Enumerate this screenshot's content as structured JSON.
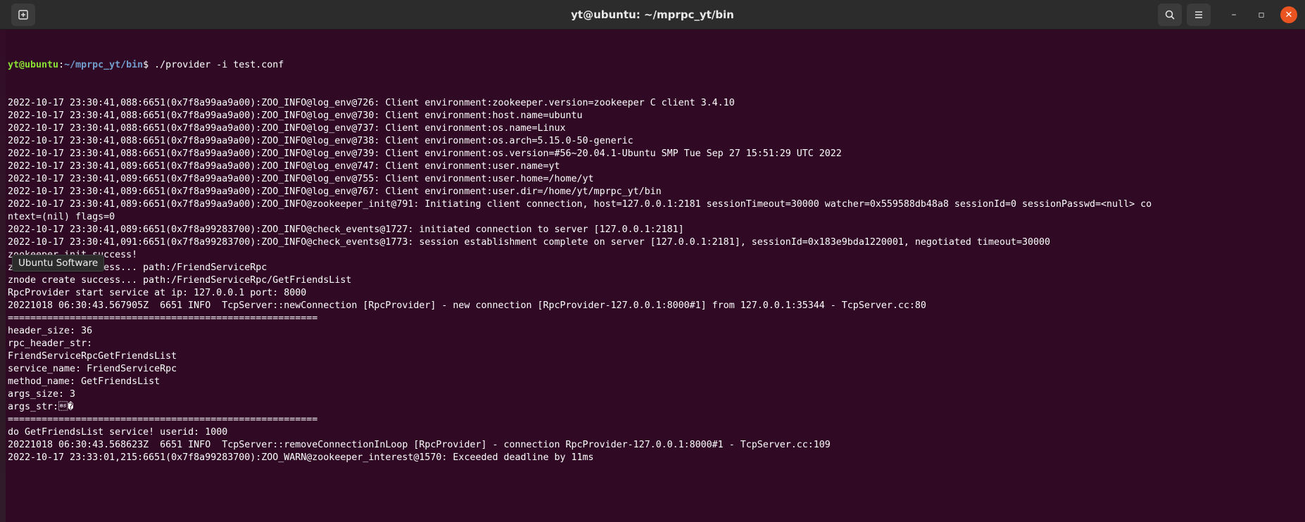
{
  "window": {
    "title": "yt@ubuntu: ~/mprpc_yt/bin",
    "icons": {
      "new_tab": "new-tab-icon",
      "search": "search-icon",
      "menu": "hamburger-menu-icon",
      "minimize": "minimize-icon",
      "maximize": "maximize-icon",
      "close": "close-icon"
    },
    "glyphs": {
      "minimize": "–",
      "maximize": "▫",
      "close": "✕"
    }
  },
  "colors": {
    "terminal_bg": "#300a24",
    "prompt_user": "#8ae234",
    "prompt_path": "#729fcf",
    "close_button": "#e95420"
  },
  "terminal": {
    "prompt": {
      "user_host": "yt@ubuntu",
      "separator": ":",
      "path": "~/mprpc_yt/bin",
      "symbol": "$ ",
      "command": "./provider -i test.conf"
    },
    "lines": [
      "2022-10-17 23:30:41,088:6651(0x7f8a99aa9a00):ZOO_INFO@log_env@726: Client environment:zookeeper.version=zookeeper C client 3.4.10",
      "2022-10-17 23:30:41,088:6651(0x7f8a99aa9a00):ZOO_INFO@log_env@730: Client environment:host.name=ubuntu",
      "2022-10-17 23:30:41,088:6651(0x7f8a99aa9a00):ZOO_INFO@log_env@737: Client environment:os.name=Linux",
      "2022-10-17 23:30:41,088:6651(0x7f8a99aa9a00):ZOO_INFO@log_env@738: Client environment:os.arch=5.15.0-50-generic",
      "2022-10-17 23:30:41,088:6651(0x7f8a99aa9a00):ZOO_INFO@log_env@739: Client environment:os.version=#56~20.04.1-Ubuntu SMP Tue Sep 27 15:51:29 UTC 2022",
      "2022-10-17 23:30:41,089:6651(0x7f8a99aa9a00):ZOO_INFO@log_env@747: Client environment:user.name=yt",
      "2022-10-17 23:30:41,089:6651(0x7f8a99aa9a00):ZOO_INFO@log_env@755: Client environment:user.home=/home/yt",
      "2022-10-17 23:30:41,089:6651(0x7f8a99aa9a00):ZOO_INFO@log_env@767: Client environment:user.dir=/home/yt/mprpc_yt/bin",
      "2022-10-17 23:30:41,089:6651(0x7f8a99aa9a00):ZOO_INFO@zookeeper_init@791: Initiating client connection, host=127.0.0.1:2181 sessionTimeout=30000 watcher=0x559588db48a8 sessionId=0 sessionPasswd=<null> co",
      "ntext=(nil) flags=0",
      "2022-10-17 23:30:41,089:6651(0x7f8a99283700):ZOO_INFO@check_events@1727: initiated connection to server [127.0.0.1:2181]",
      "2022-10-17 23:30:41,091:6651(0x7f8a99283700):ZOO_INFO@check_events@1773: session establishment complete on server [127.0.0.1:2181], sessionId=0x183e9bda1220001, negotiated timeout=30000",
      "zookeeper_init success!",
      "znode create success... path:/FriendServiceRpc",
      "znode create success... path:/FriendServiceRpc/GetFriendsList",
      "RpcProvider start service at ip: 127.0.0.1 port: 8000",
      "20221018 06:30:43.567905Z  6651 INFO  TcpServer::newConnection [RpcProvider] - new connection [RpcProvider-127.0.0.1:8000#1] from 127.0.0.1:35344 - TcpServer.cc:80",
      "=======================================================",
      "header_size: 36",
      "rpc_header_str:",
      "FriendServiceRpcGetFriendsList",
      "service_name: FriendServiceRpc",
      "method_name: GetFriendsList",
      "args_size: 3",
      "args_str:\b�",
      "=======================================================",
      "do GetFriendsList service! userid: 1000",
      "20221018 06:30:43.568623Z  6651 INFO  TcpServer::removeConnectionInLoop [RpcProvider] - connection RpcProvider-127.0.0.1:8000#1 - TcpServer.cc:109",
      "2022-10-17 23:33:01,215:6651(0x7f8a99283700):ZOO_WARN@zookeeper_interest@1570: Exceeded deadline by 11ms"
    ]
  },
  "tooltip": {
    "text": "Ubuntu Software"
  }
}
